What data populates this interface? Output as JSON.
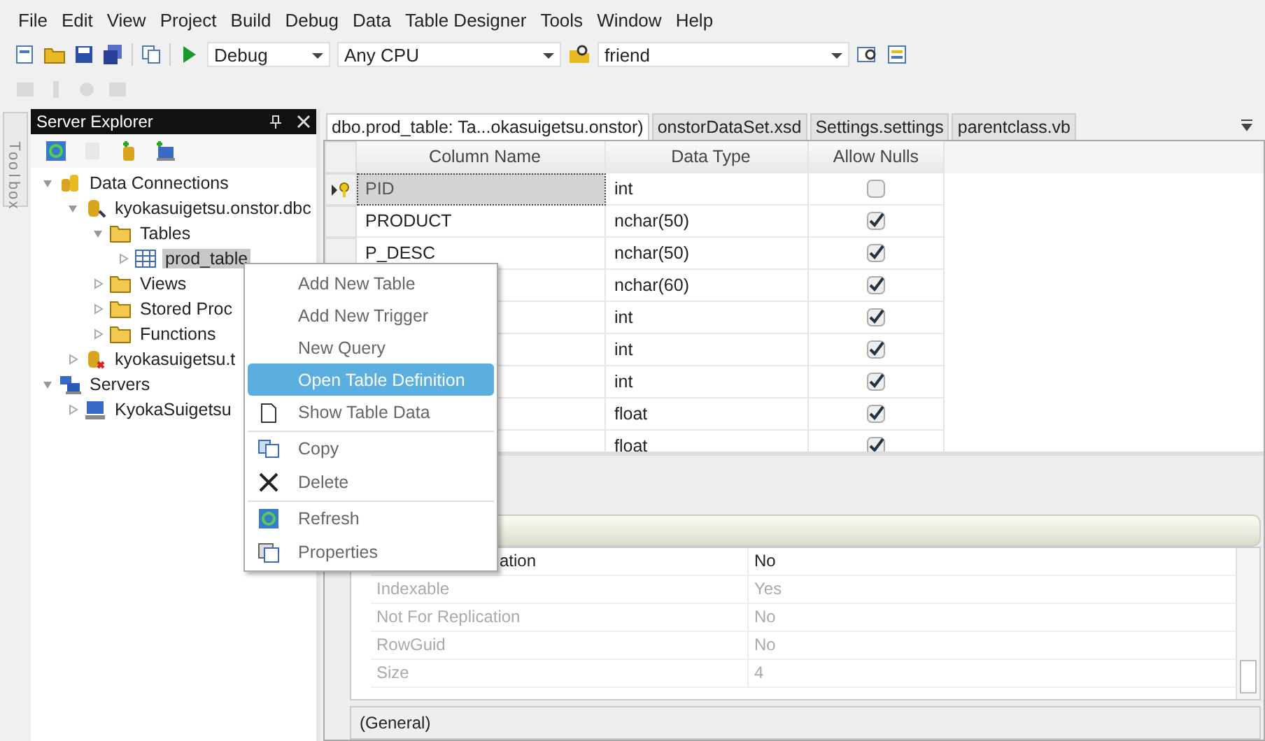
{
  "menu_bar": [
    "File",
    "Edit",
    "View",
    "Project",
    "Build",
    "Debug",
    "Data",
    "Table Designer",
    "Tools",
    "Window",
    "Help"
  ],
  "toolbar": {
    "configuration": "Debug",
    "platform": "Any CPU",
    "find": "friend"
  },
  "toolbox_tab": "Toolbox",
  "server_explorer": {
    "title": "Server Explorer",
    "tree": [
      {
        "label": "Data Connections",
        "kind": "connections",
        "expanded": true,
        "selected": false,
        "children": [
          {
            "label": "kyokasuigetsu.onstor.dbc",
            "kind": "database",
            "expanded": true,
            "selected": false,
            "children": [
              {
                "label": "Tables",
                "kind": "folder",
                "expanded": true,
                "selected": false,
                "children": [
                  {
                    "label": "prod_table",
                    "kind": "table",
                    "expanded": false,
                    "selected": true
                  }
                ]
              },
              {
                "label": "Views",
                "kind": "folder",
                "expanded": false,
                "selected": false
              },
              {
                "label": "Stored Proc",
                "kind": "folder",
                "expanded": false,
                "selected": false
              },
              {
                "label": "Functions",
                "kind": "folder",
                "expanded": false,
                "selected": false
              }
            ]
          },
          {
            "label": "kyokasuigetsu.t",
            "kind": "database-error",
            "expanded": false,
            "selected": false
          }
        ]
      },
      {
        "label": "Servers",
        "kind": "servers",
        "expanded": true,
        "selected": false,
        "children": [
          {
            "label": "KyokaSuigetsu",
            "kind": "computer",
            "expanded": false,
            "selected": false
          }
        ]
      }
    ]
  },
  "document_tabs": [
    {
      "label": "dbo.prod_table: Ta...okasuigetsu.onstor)",
      "selected": true
    },
    {
      "label": "onstorDataSet.xsd",
      "selected": false
    },
    {
      "label": "Settings.settings",
      "selected": false
    },
    {
      "label": "parentclass.vb",
      "selected": false
    }
  ],
  "table": {
    "columns": [
      "Column Name",
      "Data Type",
      "Allow Nulls"
    ],
    "rows": [
      {
        "name": "PID",
        "type": "int",
        "allow_nulls": false,
        "primary_key": true,
        "selected": true
      },
      {
        "name": "PRODUCT",
        "type": "nchar(50)",
        "allow_nulls": true,
        "primary_key": false,
        "selected": false
      },
      {
        "name": "P_DESC",
        "type": "nchar(50)",
        "allow_nulls": true,
        "primary_key": false,
        "selected": false
      },
      {
        "type": "nchar(60)",
        "allow_nulls": true
      },
      {
        "type": "int",
        "allow_nulls": true
      },
      {
        "type": "int",
        "allow_nulls": true
      },
      {
        "type": "int",
        "allow_nulls": true
      },
      {
        "type": "float",
        "allow_nulls": true
      },
      {
        "type": "float",
        "allow_nulls": true
      }
    ]
  },
  "properties": {
    "rows": [
      {
        "name": "ation",
        "value": "No",
        "disabled": false
      },
      {
        "name": "Indexable",
        "value": "Yes",
        "disabled": true
      },
      {
        "name": "Not For Replication",
        "value": "No",
        "disabled": true
      },
      {
        "name": "RowGuid",
        "value": "No",
        "disabled": true
      },
      {
        "name": "Size",
        "value": "4",
        "disabled": true
      }
    ],
    "description": "(General)"
  },
  "context_menu": [
    {
      "label": "Add New Table",
      "kind": "plain",
      "selected": false,
      "separator_before": false
    },
    {
      "label": "Add New Trigger",
      "kind": "plain",
      "selected": false,
      "separator_before": false
    },
    {
      "label": "New Query",
      "kind": "plain",
      "selected": false,
      "separator_before": false
    },
    {
      "label": "Open Table Definition",
      "kind": "plain",
      "selected": true,
      "separator_before": false
    },
    {
      "label": "Show Table Data",
      "kind": "document",
      "selected": false,
      "separator_before": false
    },
    {
      "label": "Copy",
      "kind": "copy",
      "selected": false,
      "separator_before": true
    },
    {
      "label": "Delete",
      "kind": "delete",
      "selected": false,
      "separator_before": false
    },
    {
      "label": "Refresh",
      "kind": "refresh",
      "selected": false,
      "separator_before": true
    },
    {
      "label": "Properties",
      "kind": "properties",
      "selected": false,
      "separator_before": false
    }
  ]
}
